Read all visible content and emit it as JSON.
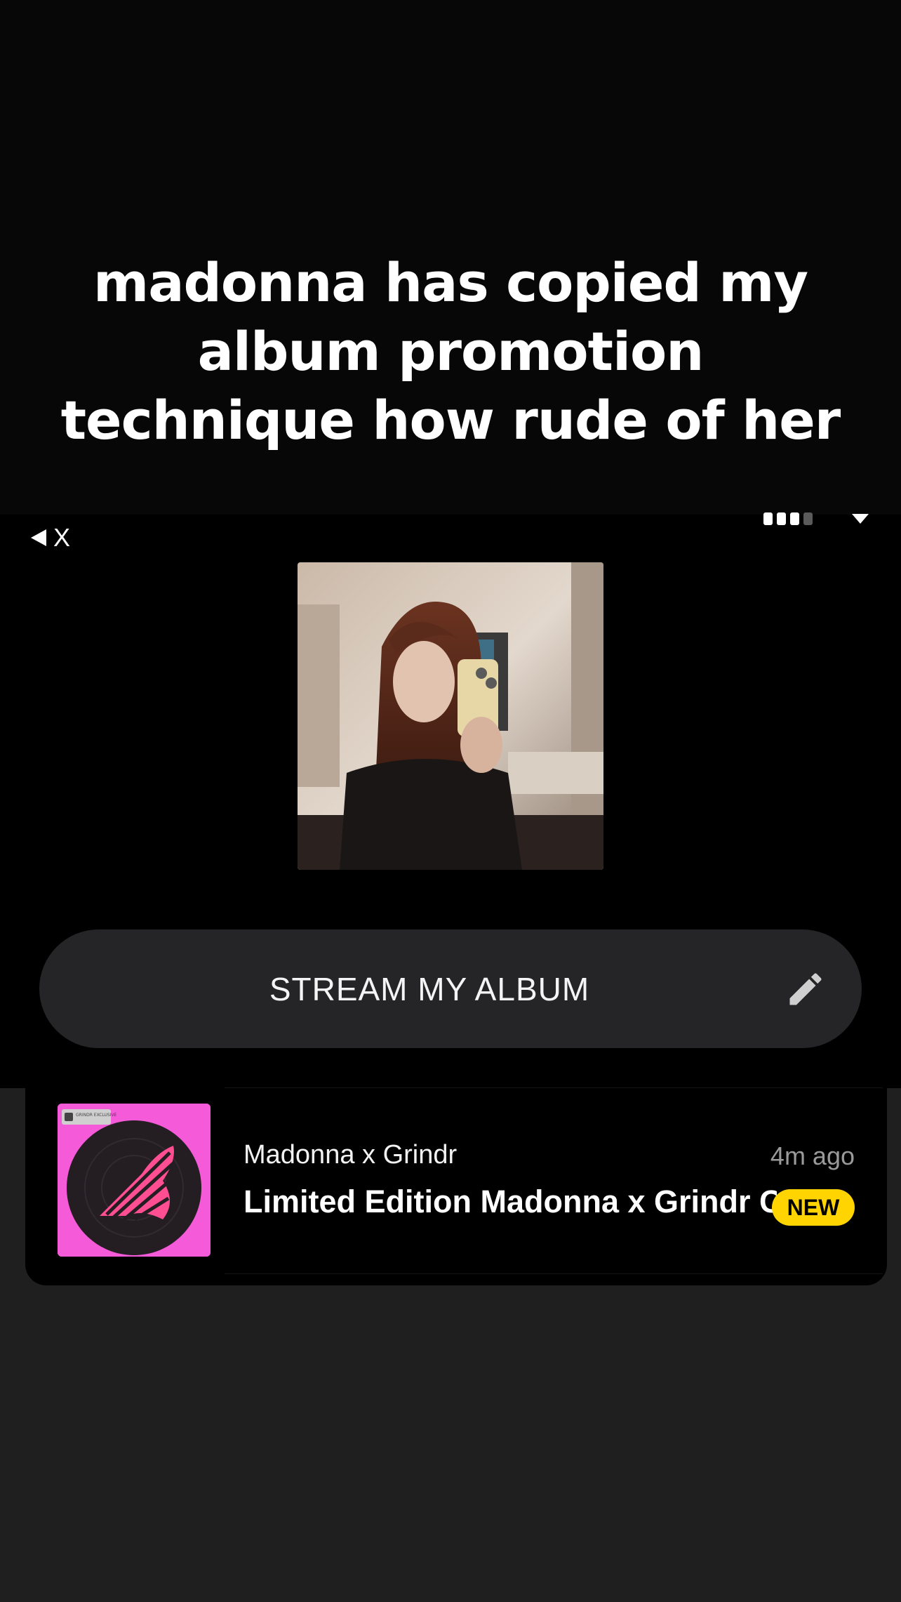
{
  "caption": {
    "text": "madonna has copied my album promotion technique how rude of her"
  },
  "status_bar": {
    "back_app_label": "X"
  },
  "profile": {
    "photo_icon": "selfie-photo"
  },
  "stream_button": {
    "label": "STREAM MY ALBUM",
    "edit_icon": "pencil-icon"
  },
  "notification": {
    "sender": "Madonna x Grindr",
    "time": "4m ago",
    "title": "Limited Edition Madonna x Grindr C",
    "badge": "NEW",
    "art_badge_text": "GRINDR EXCLUSIVE"
  },
  "colors": {
    "badge": "#ffd400",
    "album_art_bg": "#f55ad9",
    "button_bg": "#252527"
  }
}
